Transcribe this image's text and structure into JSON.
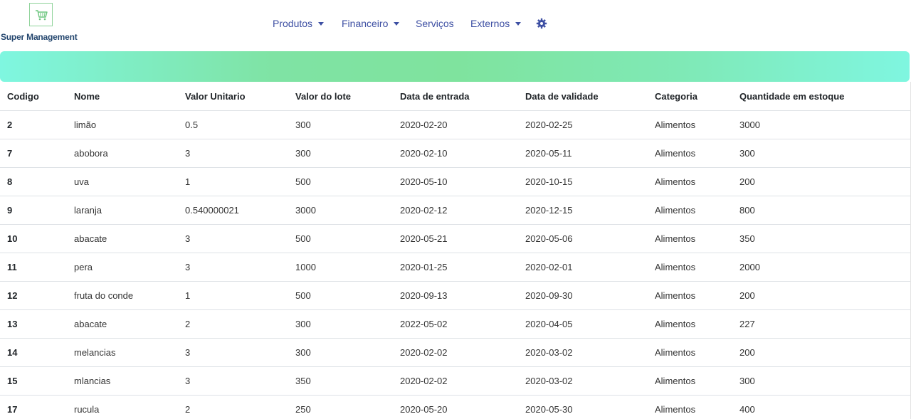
{
  "brand": {
    "name": "Super Management",
    "logo_icon": "shopping-cart-icon",
    "logo_color": "#8fd39a",
    "name_color": "#24466e"
  },
  "nav": {
    "produtos": "Produtos",
    "financeiro": "Financeiro",
    "servicos": "Serviços",
    "externos": "Externos",
    "settings_icon": "gear-icon",
    "link_color": "#3d4fa3"
  },
  "banner": {
    "gradient_colors": [
      "#7ff6e0",
      "#7fe39e",
      "#7ff6e0"
    ]
  },
  "table": {
    "headers": [
      "Codigo",
      "Nome",
      "Valor Unitario",
      "Valor do lote",
      "Data de entrada",
      "Data de validade",
      "Categoria",
      "Quantidade em estoque"
    ],
    "rows": [
      [
        "2",
        "limão",
        "0.5",
        "300",
        "2020-02-20",
        "2020-02-25",
        "Alimentos",
        "3000"
      ],
      [
        "7",
        "abobora",
        "3",
        "300",
        "2020-02-10",
        "2020-05-11",
        "Alimentos",
        "300"
      ],
      [
        "8",
        "uva",
        "1",
        "500",
        "2020-05-10",
        "2020-10-15",
        "Alimentos",
        "200"
      ],
      [
        "9",
        "laranja",
        "0.540000021",
        "3000",
        "2020-02-12",
        "2020-12-15",
        "Alimentos",
        "800"
      ],
      [
        "10",
        "abacate",
        "3",
        "500",
        "2020-05-21",
        "2020-05-06",
        "Alimentos",
        "350"
      ],
      [
        "11",
        "pera",
        "3",
        "1000",
        "2020-01-25",
        "2020-02-01",
        "Alimentos",
        "2000"
      ],
      [
        "12",
        "fruta do conde",
        "1",
        "500",
        "2020-09-13",
        "2020-09-30",
        "Alimentos",
        "200"
      ],
      [
        "13",
        "abacate",
        "2",
        "300",
        "2022-05-02",
        "2020-04-05",
        "Alimentos",
        "227"
      ],
      [
        "14",
        "melancias",
        "3",
        "300",
        "2020-02-02",
        "2020-03-02",
        "Alimentos",
        "200"
      ],
      [
        "15",
        "mlancias",
        "3",
        "350",
        "2020-02-02",
        "2020-03-02",
        "Alimentos",
        "300"
      ],
      [
        "17",
        "rucula",
        "2",
        "250",
        "2020-05-20",
        "2020-05-30",
        "Alimentos",
        "400"
      ]
    ]
  }
}
